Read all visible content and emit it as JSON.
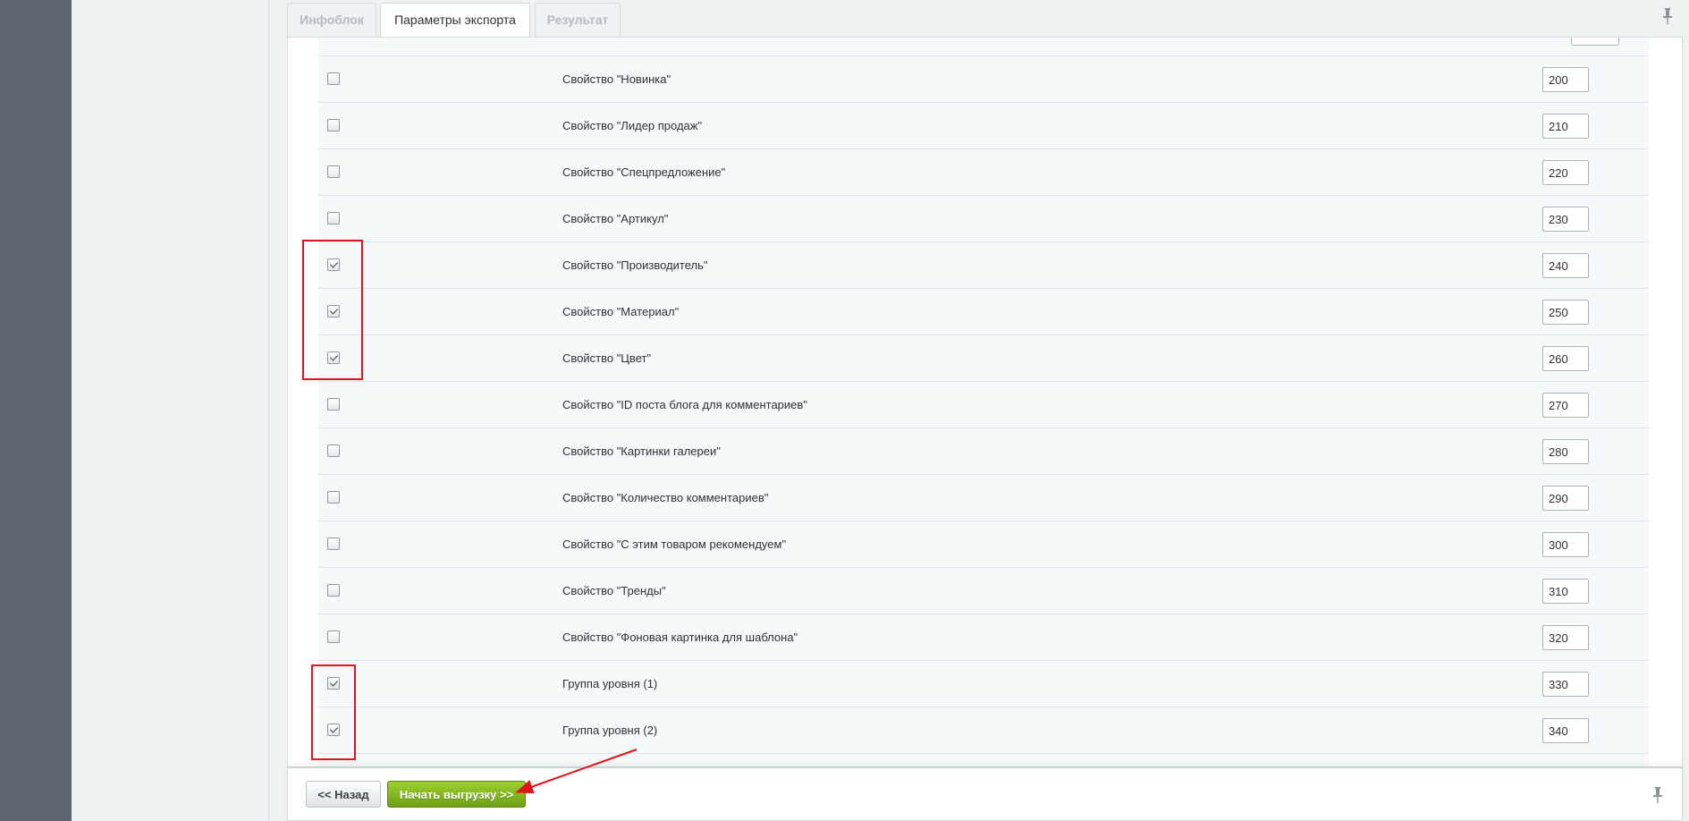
{
  "tabs": [
    {
      "label": "Инфоблок",
      "active": false
    },
    {
      "label": "Параметры экспорта",
      "active": true
    },
    {
      "label": "Результат",
      "active": false
    }
  ],
  "rows": [
    {
      "label": "Свойство \"Новинка\"",
      "checked": false,
      "sort": "200"
    },
    {
      "label": "Свойство \"Лидер продаж\"",
      "checked": false,
      "sort": "210"
    },
    {
      "label": "Свойство \"Спецпредложение\"",
      "checked": false,
      "sort": "220"
    },
    {
      "label": "Свойство \"Артикул\"",
      "checked": false,
      "sort": "230"
    },
    {
      "label": "Свойство \"Производитель\"",
      "checked": true,
      "sort": "240"
    },
    {
      "label": "Свойство \"Материал\"",
      "checked": true,
      "sort": "250"
    },
    {
      "label": "Свойство \"Цвет\"",
      "checked": true,
      "sort": "260"
    },
    {
      "label": "Свойство \"ID поста блога для комментариев\"",
      "checked": false,
      "sort": "270"
    },
    {
      "label": "Свойство \"Картинки галереи\"",
      "checked": false,
      "sort": "280"
    },
    {
      "label": "Свойство \"Количество комментариев\"",
      "checked": false,
      "sort": "290"
    },
    {
      "label": "Свойство \"С этим товаром рекомендуем\"",
      "checked": false,
      "sort": "300"
    },
    {
      "label": "Свойство \"Тренды\"",
      "checked": false,
      "sort": "310"
    },
    {
      "label": "Свойство \"Фоновая картинка для шаблона\"",
      "checked": false,
      "sort": "320"
    },
    {
      "label": "Группа уровня (1)",
      "checked": true,
      "sort": "330"
    },
    {
      "label": "Группа уровня (2)",
      "checked": true,
      "sort": "340"
    }
  ],
  "footer": {
    "back_label": "<< Назад",
    "start_label": "Начать выгрузку >>"
  },
  "icons": {
    "pin": "pin-icon"
  },
  "colors": {
    "start_button": "#7cb21e",
    "highlight": "#e0151b",
    "left_rail": "#5d6670"
  }
}
